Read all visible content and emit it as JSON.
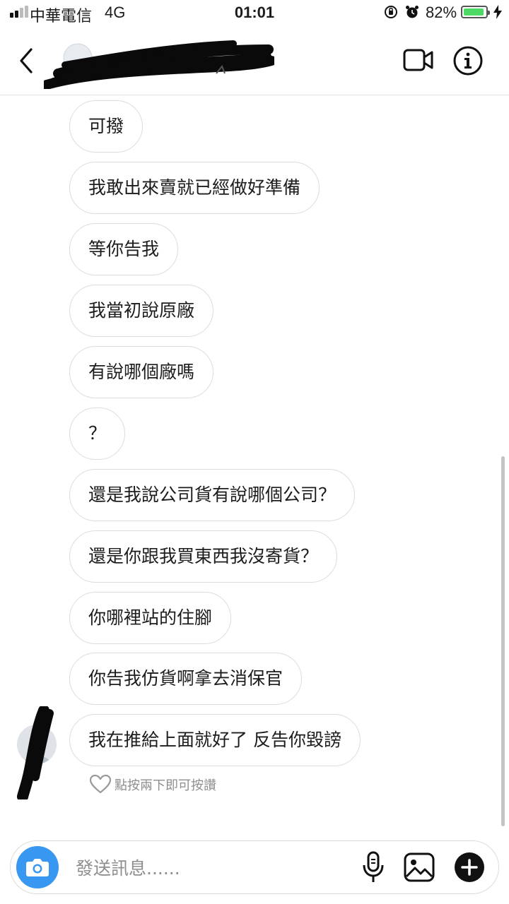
{
  "status_bar": {
    "carrier": "中華電信",
    "network": "4G",
    "time": "01:01",
    "battery_percent_label": "82%",
    "battery_level": 0.82,
    "battery_color": "#4cd964"
  },
  "header": {
    "back_icon": "chevron-left-icon",
    "video_icon": "video-camera-icon",
    "info_icon": "info-icon"
  },
  "messages": [
    {
      "text": "可撥"
    },
    {
      "text": "我敢出來賣就已經做好準備"
    },
    {
      "text": "等你告我"
    },
    {
      "text": "我當初說原廠"
    },
    {
      "text": "有說哪個廠嗎"
    },
    {
      "text": "？"
    },
    {
      "text": "還是我說公司貨有說哪個公司？"
    },
    {
      "text": "還是你跟我買東西我沒寄貨？"
    },
    {
      "text": "你哪裡站的住腳"
    },
    {
      "text": "你告我仿貨啊拿去消保官"
    },
    {
      "text": "我在推給上面就好了 反告你毀謗"
    }
  ],
  "like_hint": {
    "icon": "heart-outline-icon",
    "text": "點按兩下即可按讚"
  },
  "composer": {
    "placeholder": "發送訊息......",
    "value": "",
    "camera_color": "#3897f0"
  }
}
